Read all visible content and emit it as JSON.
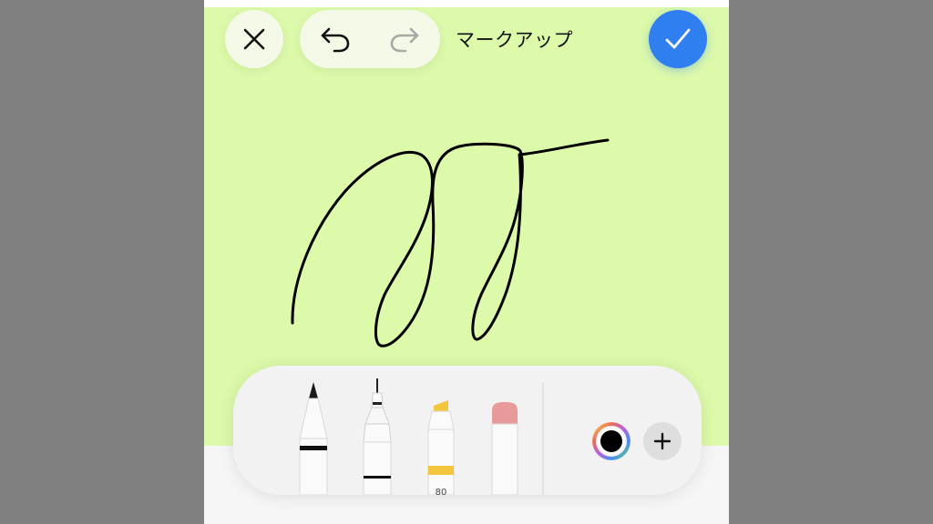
{
  "screen": {
    "title": "マークアップ"
  },
  "toolbar": {
    "tools": [
      {
        "name": "pen",
        "tip_color": "#222222",
        "band_color": "#111111"
      },
      {
        "name": "fineliner",
        "tip_color": "#222222",
        "band_color": "#111111"
      },
      {
        "name": "highlighter",
        "tip_color": "#f2c53d",
        "band_color": "#f2c53d",
        "label": "80"
      },
      {
        "name": "eraser",
        "tip_color": "#e79a9a"
      }
    ],
    "selected_color": "#000000"
  },
  "colors": {
    "canvas": "#ddfaaa",
    "accent": "#2f7ff0",
    "ink": "#000000"
  },
  "icons": {
    "close": "close-icon",
    "undo": "undo-icon",
    "redo": "redo-icon",
    "done": "checkmark-icon",
    "add": "plus-icon"
  }
}
